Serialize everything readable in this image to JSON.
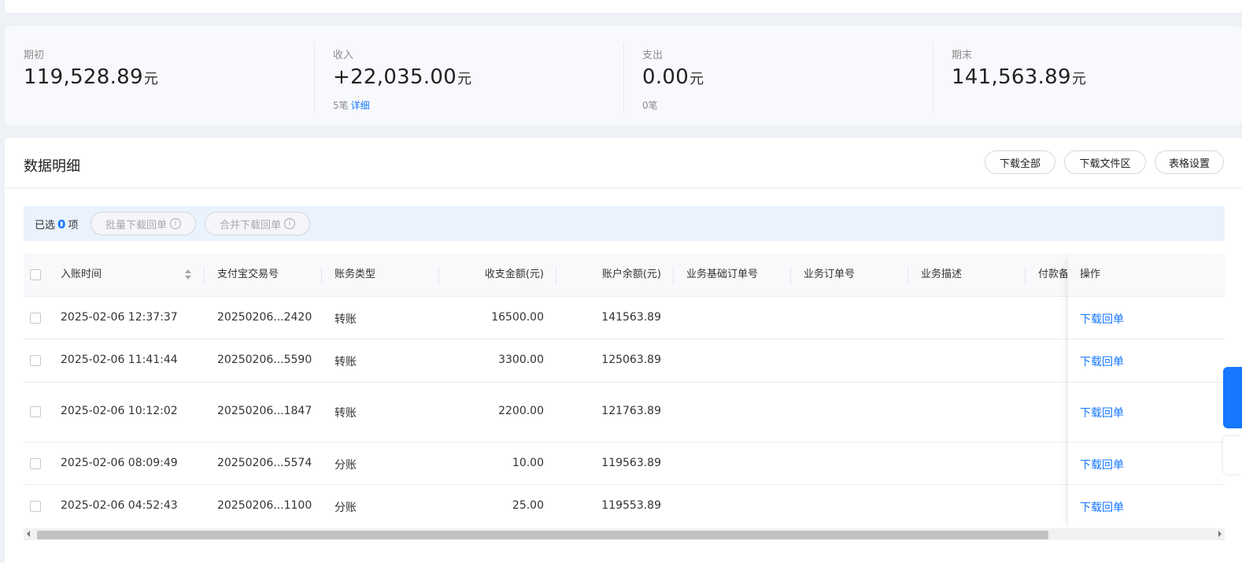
{
  "summary": {
    "opening": {
      "label": "期初",
      "value": "119,528.89",
      "unit": "元"
    },
    "income": {
      "label": "收入",
      "value": "+22,035.00",
      "unit": "元",
      "count": "5笔",
      "detail_link": "详细"
    },
    "expense": {
      "label": "支出",
      "value": "0.00",
      "unit": "元",
      "count": "0笔"
    },
    "closing": {
      "label": "期末",
      "value": "141,563.89",
      "unit": "元"
    }
  },
  "detail": {
    "title": "数据明细",
    "buttons": {
      "download_all": "下载全部",
      "download_area": "下载文件区",
      "table_settings": "表格设置"
    }
  },
  "selection": {
    "prefix": "已选",
    "count": "0",
    "suffix": "项",
    "batch_download": "批量下载回单",
    "merge_download": "合并下载回单"
  },
  "table": {
    "columns": {
      "time": "入账时间",
      "trade_no": "支付宝交易号",
      "type": "账务类型",
      "amount": "收支金额(元)",
      "balance": "账户余额(元)",
      "base_order": "业务基础订单号",
      "order": "业务订单号",
      "desc": "业务描述",
      "payer_note": "付款备",
      "action": "操作"
    },
    "rows": [
      {
        "time": "2025-02-06 12:37:37",
        "trade_no": "20250206...2420",
        "type": "转账",
        "amount": "16500.00",
        "balance": "141563.89",
        "action": "下载回单"
      },
      {
        "time": "2025-02-06 11:41:44",
        "trade_no": "20250206...5590",
        "type": "转账",
        "amount": "3300.00",
        "balance": "125063.89",
        "action": "下载回单"
      },
      {
        "time": "2025-02-06 10:12:02",
        "trade_no": "20250206...1847",
        "type": "转账",
        "amount": "2200.00",
        "balance": "121763.89",
        "action": "下载回单"
      },
      {
        "time": "2025-02-06 08:09:49",
        "trade_no": "20250206...5574",
        "type": "分账",
        "amount": "10.00",
        "balance": "119563.89",
        "action": "下载回单"
      },
      {
        "time": "2025-02-06 04:52:43",
        "trade_no": "20250206...1100",
        "type": "分账",
        "amount": "25.00",
        "balance": "119553.89",
        "action": "下载回单"
      }
    ]
  },
  "colors": {
    "accent": "#1677ff",
    "select_bar": "#eaf2fe"
  },
  "icons": {
    "sort": "sort-icon",
    "info": "info-icon"
  }
}
